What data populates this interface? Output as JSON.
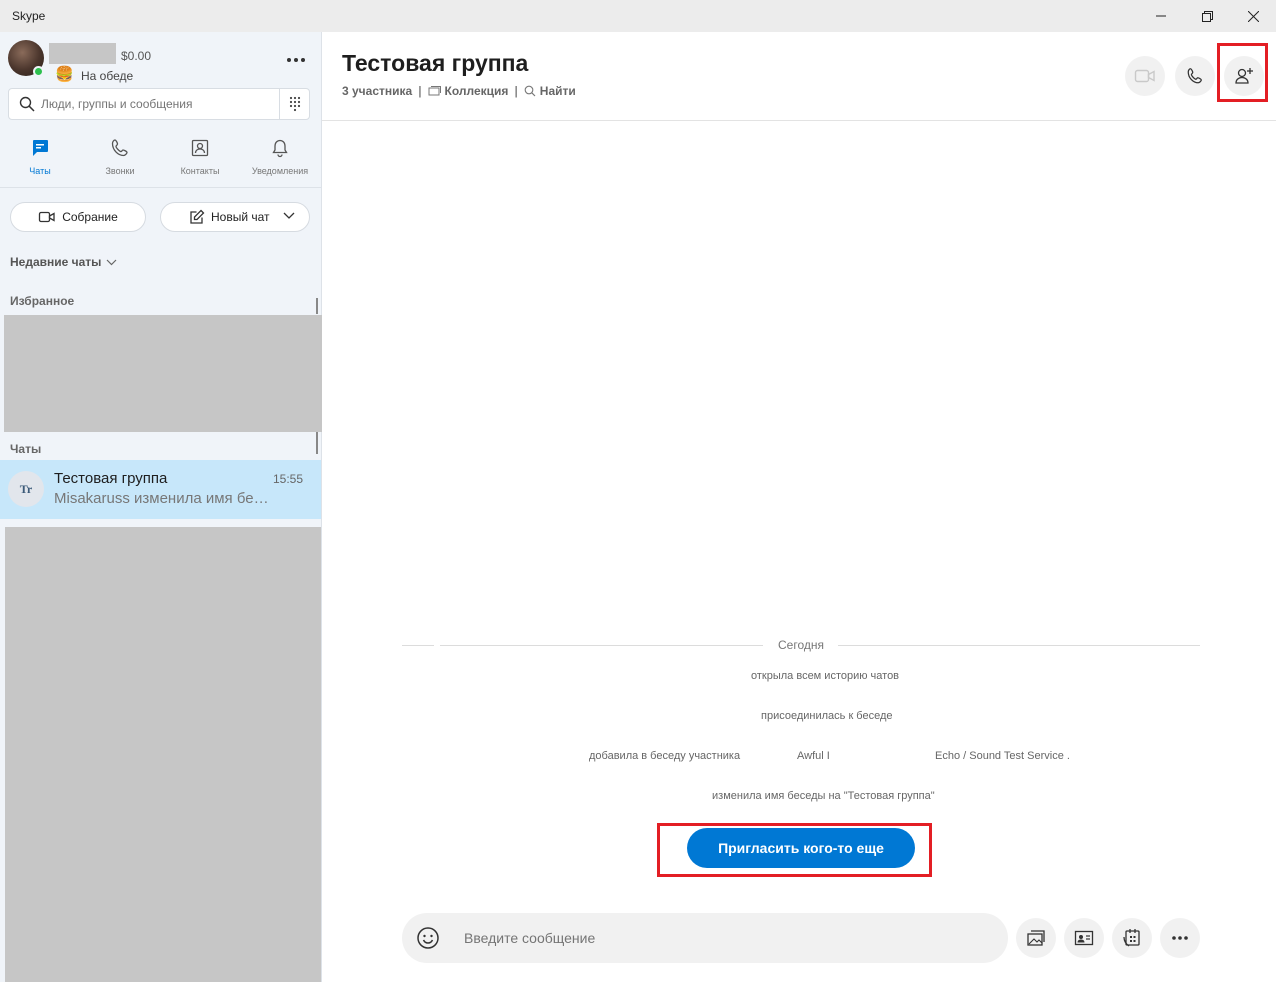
{
  "window": {
    "title": "Skype"
  },
  "profile": {
    "balance": "$0.00",
    "mood_emoji": "🍔",
    "mood": "На обеде",
    "presence_color": "#2ec04f"
  },
  "search": {
    "placeholder": "Люди, группы и сообщения",
    "value": ""
  },
  "nav_tabs": [
    {
      "label": "Чаты",
      "icon": "chat-icon",
      "active": true
    },
    {
      "label": "Звонки",
      "icon": "phone-icon",
      "active": false
    },
    {
      "label": "Контакты",
      "icon": "contacts-icon",
      "active": false
    },
    {
      "label": "Уведомления",
      "icon": "bell-icon",
      "active": false
    }
  ],
  "actions": {
    "meeting_label": "Собрание",
    "new_chat_label": "Новый чат"
  },
  "sections": {
    "recent": "Недавние чаты",
    "favorites": "Избранное",
    "chats": "Чаты"
  },
  "chat_list": [
    {
      "initials": "Tr",
      "name": "Тестовая группа",
      "time": "15:55",
      "preview": "Misakaruss изменила имя беседы на \"Тестовая группа\"",
      "selected": true
    }
  ],
  "conversation": {
    "title": "Тестовая группа",
    "participants": "3 участника",
    "collection": "Коллекция",
    "find": "Найти",
    "day_label": "Сегодня",
    "system_messages": [
      {
        "text": "открыла всем историю чатов"
      },
      {
        "text": "присоединилась к беседе"
      },
      {
        "text": "добавила в беседу участника",
        "extra_a": "Awful I",
        "extra_b": "Echo / Sound Test Service ."
      },
      {
        "text": "изменила имя беседы на \"Тестовая группа\""
      }
    ],
    "invite_button": "Пригласить кого-то еще",
    "composer_placeholder": "Введите сообщение"
  },
  "colors": {
    "accent": "#0078d4",
    "highlight_border": "#e31e24",
    "selected_row": "#c7e7fa",
    "sidebar_bg": "#f0f4f9"
  }
}
